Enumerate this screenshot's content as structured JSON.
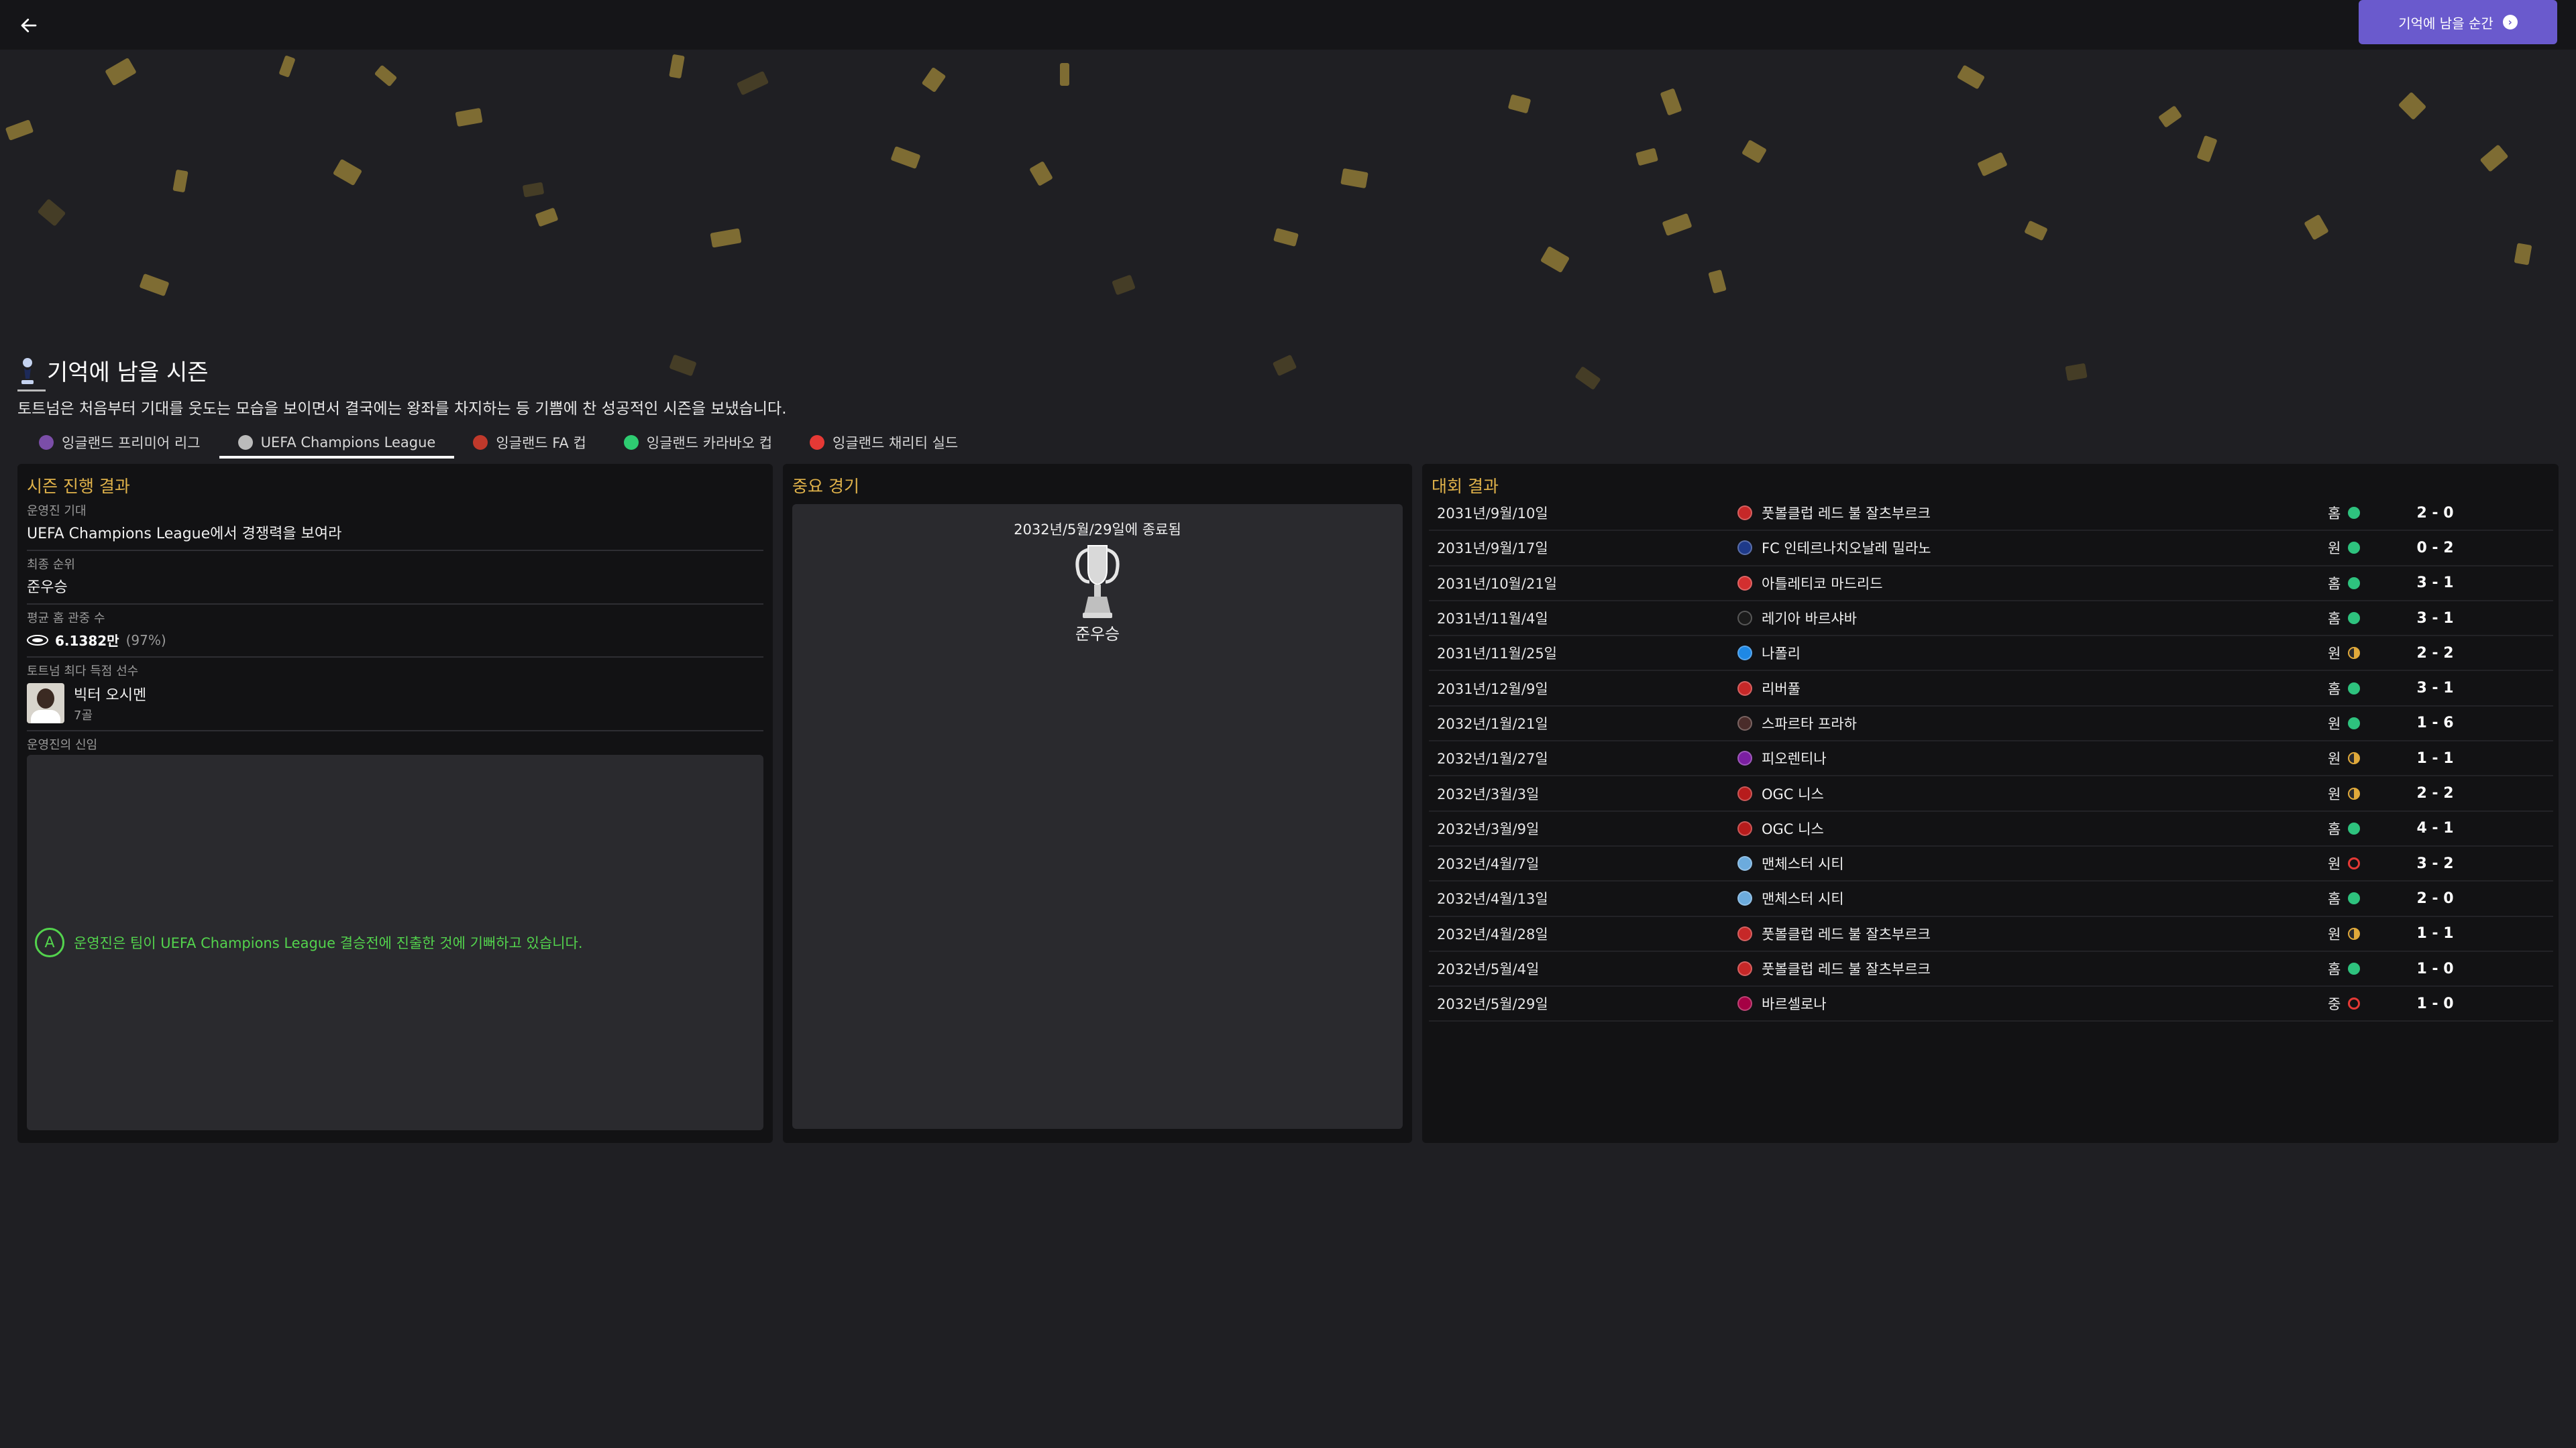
{
  "topbar": {
    "back_icon": "arrow-left-icon",
    "action_label": "기억에 남을 순간",
    "action_icon": "chevron-right-circle-icon",
    "accent_color": "#6a5acd"
  },
  "heading": {
    "icon": "trophy-cockerel-icon",
    "title": "기억에 남을 시즌",
    "description": "토트넘은 처음부터 기대를 웃도는 모습을 보이면서 결국에는 왕좌를 차지하는 등 기쁨에 찬 성공적인 시즌을 보냈습니다."
  },
  "tabs": [
    {
      "label": "잉글랜드 프리미어 리그",
      "icon": "premier-league-icon",
      "color": "#7b4ea8"
    },
    {
      "label": "UEFA Champions League",
      "icon": "champions-league-icon",
      "color": "#bbbbbb",
      "active": true
    },
    {
      "label": "잉글랜드 FA 컵",
      "icon": "fa-cup-icon",
      "color": "#c0392b"
    },
    {
      "label": "잉글랜드 카라바오 컵",
      "icon": "carabao-cup-icon",
      "color": "#2ecc71"
    },
    {
      "label": "잉글랜드 채리티 실드",
      "icon": "charity-shield-icon",
      "color": "#e53935"
    }
  ],
  "season": {
    "title": "시즌 진행 결과",
    "expectation_label": "운영진 기대",
    "expectation_value": "UEFA Champions League에서 경쟁력을 보여라",
    "final_label": "최종 순위",
    "final_value": "준우승",
    "attendance_label": "평균 홈 관중 수",
    "attendance_value": "6.1382만",
    "attendance_pct": "(97%)",
    "scorer_label": "토트넘 최다 득점 선수",
    "scorer_name": "빅터 오시멘",
    "scorer_goals": "7골",
    "trust_label": "운영진의 신임",
    "trust_grade": "A",
    "trust_message": "운영진은 팀이 UEFA Champions League 결승전에 진출한 것에 기뻐하고 있습니다."
  },
  "key_match": {
    "title": "중요 경기",
    "date": "2032년/5월/29일에 종료됨",
    "result": "준우승",
    "icon": "champions-league-trophy-icon"
  },
  "results": {
    "title": "대회 결과",
    "rows": [
      {
        "date": "2031년/9월/10일",
        "opponent": "풋볼클럽 레드 불 잘츠부르크",
        "venue": "홈",
        "outcome": "win",
        "score": "2 - 0",
        "crest": "#c62828"
      },
      {
        "date": "2031년/9월/17일",
        "opponent": "FC 인테르나치오날레 밀라노",
        "venue": "원",
        "outcome": "win",
        "score": "0 - 2",
        "crest": "#1e3a8a"
      },
      {
        "date": "2031년/10월/21일",
        "opponent": "아틀레티코 마드리드",
        "venue": "홈",
        "outcome": "win",
        "score": "3 - 1",
        "crest": "#d32f2f"
      },
      {
        "date": "2031년/11월/4일",
        "opponent": "레기아 바르샤바",
        "venue": "홈",
        "outcome": "win",
        "score": "3 - 1",
        "crest": "#1b1b1b"
      },
      {
        "date": "2031년/11월/25일",
        "opponent": "나폴리",
        "venue": "원",
        "outcome": "draw",
        "score": "2 - 2",
        "crest": "#1e88e5"
      },
      {
        "date": "2031년/12월/9일",
        "opponent": "리버풀",
        "venue": "홈",
        "outcome": "win",
        "score": "3 - 1",
        "crest": "#c62828"
      },
      {
        "date": "2032년/1월/21일",
        "opponent": "스파르타 프라하",
        "venue": "원",
        "outcome": "win",
        "score": "1 - 6",
        "crest": "#4a2c2a"
      },
      {
        "date": "2032년/1월/27일",
        "opponent": "피오렌티나",
        "venue": "원",
        "outcome": "draw",
        "score": "1 - 1",
        "crest": "#7b1fa2"
      },
      {
        "date": "2032년/3월/3일",
        "opponent": "OGC 니스",
        "venue": "원",
        "outcome": "draw",
        "score": "2 - 2",
        "crest": "#b71c1c"
      },
      {
        "date": "2032년/3월/9일",
        "opponent": "OGC 니스",
        "venue": "홈",
        "outcome": "win",
        "score": "4 - 1",
        "crest": "#b71c1c"
      },
      {
        "date": "2032년/4월/7일",
        "opponent": "맨체스터 시티",
        "venue": "원",
        "outcome": "loss",
        "score": "3 - 2",
        "crest": "#6cabdd"
      },
      {
        "date": "2032년/4월/13일",
        "opponent": "맨체스터 시티",
        "venue": "홈",
        "outcome": "win",
        "score": "2 - 0",
        "crest": "#6cabdd"
      },
      {
        "date": "2032년/4월/28일",
        "opponent": "풋볼클럽 레드 불 잘츠부르크",
        "venue": "원",
        "outcome": "draw",
        "score": "1 - 1",
        "crest": "#c62828"
      },
      {
        "date": "2032년/5월/4일",
        "opponent": "풋볼클럽 레드 불 잘츠부르크",
        "venue": "홈",
        "outcome": "win",
        "score": "1 - 0",
        "crest": "#c62828"
      },
      {
        "date": "2032년/5월/29일",
        "opponent": "바르셀로나",
        "venue": "중",
        "outcome": "loss",
        "score": "1 - 0",
        "crest": "#a50044"
      }
    ]
  },
  "colors": {
    "win": "#2ec27e",
    "draw": "#e0a93a",
    "loss": "#e53935",
    "panel_title": "#e0b24a",
    "trust_text": "#53d34d"
  }
}
